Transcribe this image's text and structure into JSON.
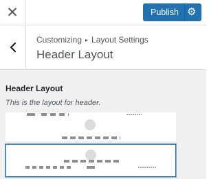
{
  "topbar": {
    "close_icon": "close-icon",
    "publish_label": "Publish",
    "settings_icon": "gear-icon",
    "accent_color": "#2271b1"
  },
  "nav": {
    "back_icon": "chevron-left-icon",
    "breadcrumb_root": "Customizing",
    "breadcrumb_section": "Layout Settings",
    "title": "Header Layout"
  },
  "control": {
    "title": "Header Layout",
    "description": "This is the layout for header."
  },
  "layout_options": [
    {
      "id": "layout-1",
      "selected": false
    },
    {
      "id": "layout-2",
      "selected": true
    }
  ]
}
